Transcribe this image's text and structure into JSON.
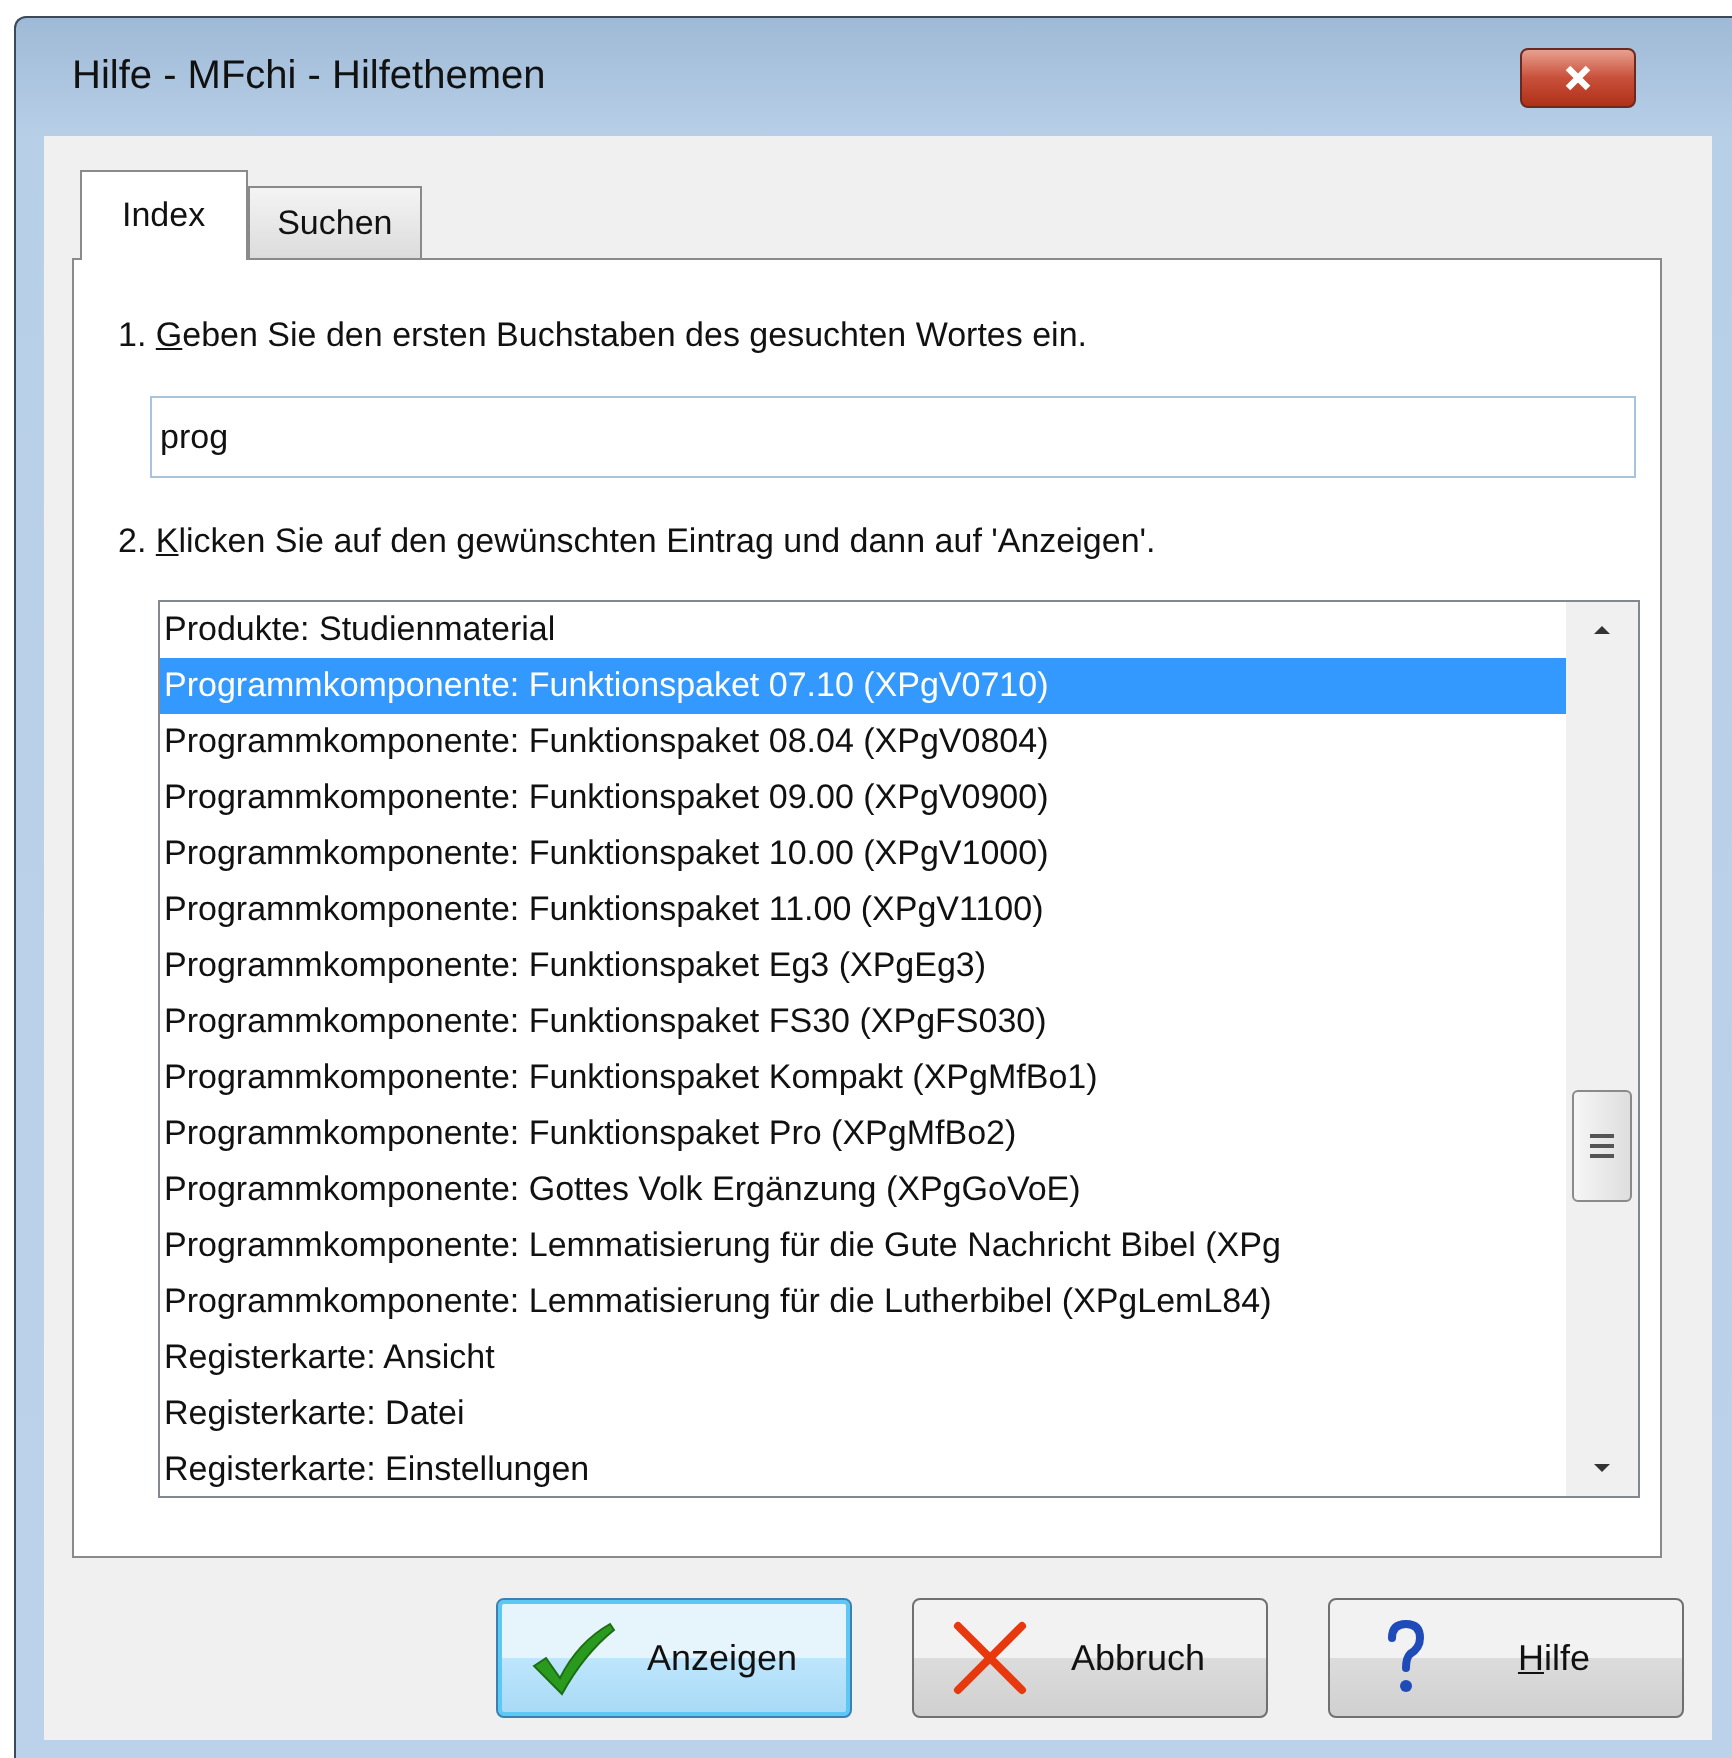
{
  "window": {
    "title": "Hilfe - MFchi - Hilfethemen"
  },
  "tabs": [
    {
      "label": "Index",
      "selected": true
    },
    {
      "label": "Suchen",
      "selected": false
    }
  ],
  "step_1": {
    "number": "1.",
    "mnemonic": "G",
    "rest": "eben Sie den ersten Buchstaben des gesuchten Wortes ein."
  },
  "search": {
    "value": "prog"
  },
  "step_2": {
    "number": "2.",
    "mnemonic": "K",
    "rest": "licken Sie auf den gewünschten Eintrag und dann auf 'Anzeigen'."
  },
  "list": [
    {
      "text": "Produkte: Studienmaterial",
      "selected": false
    },
    {
      "text": "Programmkomponente: Funktionspaket 07.10 (XPgV0710)",
      "selected": true
    },
    {
      "text": "Programmkomponente: Funktionspaket 08.04 (XPgV0804)",
      "selected": false
    },
    {
      "text": "Programmkomponente: Funktionspaket 09.00 (XPgV0900)",
      "selected": false
    },
    {
      "text": "Programmkomponente: Funktionspaket 10.00 (XPgV1000)",
      "selected": false
    },
    {
      "text": "Programmkomponente: Funktionspaket 11.00 (XPgV1100)",
      "selected": false
    },
    {
      "text": "Programmkomponente: Funktionspaket Eg3 (XPgEg3)",
      "selected": false
    },
    {
      "text": "Programmkomponente: Funktionspaket FS30 (XPgFS030)",
      "selected": false
    },
    {
      "text": "Programmkomponente: Funktionspaket Kompakt (XPgMfBo1)",
      "selected": false
    },
    {
      "text": "Programmkomponente: Funktionspaket Pro (XPgMfBo2)",
      "selected": false
    },
    {
      "text": "Programmkomponente: Gottes Volk Ergänzung (XPgGoVoE)",
      "selected": false
    },
    {
      "text": "Programmkomponente: Lemmatisierung für die Gute Nachricht Bibel (XPg",
      "selected": false
    },
    {
      "text": "Programmkomponente: Lemmatisierung für die Lutherbibel (XPgLemL84)",
      "selected": false
    },
    {
      "text": "Registerkarte: Ansicht",
      "selected": false
    },
    {
      "text": "Registerkarte: Datei",
      "selected": false
    },
    {
      "text": "Registerkarte: Einstellungen",
      "selected": false
    }
  ],
  "buttons": [
    {
      "kind": "ok",
      "label": "Anzeigen",
      "default": true
    },
    {
      "kind": "cancel",
      "label": "Abbruch",
      "default": false
    },
    {
      "kind": "help",
      "mnemonic": "H",
      "label": "ilfe",
      "default": false
    }
  ]
}
